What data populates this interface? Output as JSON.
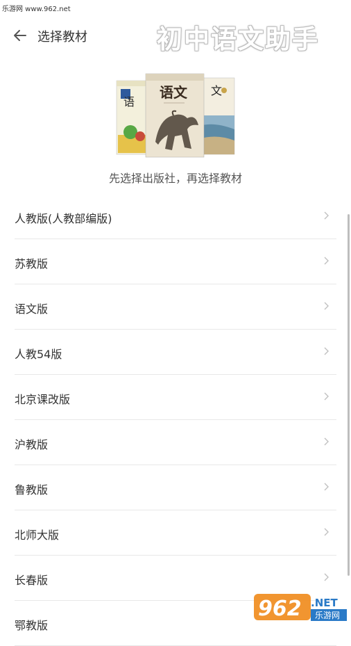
{
  "watermark_top": "乐游网 www.962.net",
  "header": {
    "title": "选择教材",
    "back_icon": "arrow-left-icon"
  },
  "promo_overlay": "初中语文助手",
  "subtitle": "先选择出版社，再选择教材",
  "publishers": [
    {
      "label": "人教版(人教部编版)"
    },
    {
      "label": "苏教版"
    },
    {
      "label": "语文版"
    },
    {
      "label": "人教54版"
    },
    {
      "label": "北京课改版"
    },
    {
      "label": "沪教版"
    },
    {
      "label": "鲁教版"
    },
    {
      "label": "北师大版"
    },
    {
      "label": "长春版"
    },
    {
      "label": "鄂教版"
    }
  ],
  "books_image": {
    "center_title": "语文",
    "right_title": "文",
    "left_title": "语"
  },
  "logo": {
    "number": "962",
    "suffix": ".NET",
    "tagline": "乐游网"
  },
  "colors": {
    "text": "#333333",
    "divider": "#e8e8e8",
    "chevron": "#c0c0c0",
    "logo_orange": "#f08c1e",
    "logo_blue": "#2a7ac7"
  }
}
